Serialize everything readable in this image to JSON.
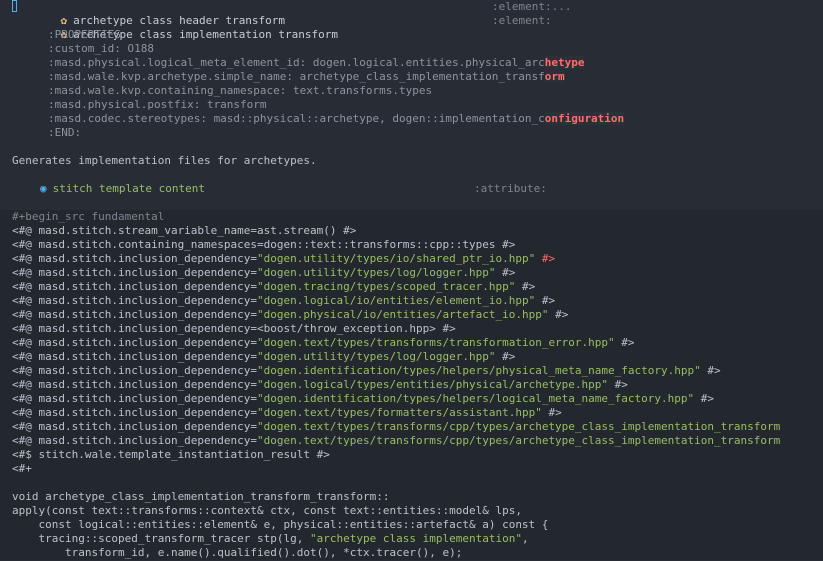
{
  "outline": {
    "header_transform": {
      "title": "archetype class header transform",
      "tag": ":element:..."
    },
    "impl_transform": {
      "title": "archetype class implementation transform",
      "tag": ":element:"
    },
    "properties": [
      ":PROPERTIES:",
      ":custom_id: O188",
      ":masd.physical.logical_meta_element_id: dogen.logical.entities.physical_arc",
      ":masd.wale.kvp.archetype.simple_name: archetype_class_implementation_transf",
      ":masd.wale.kvp.containing_namespace: text.transforms.types",
      ":masd.physical.postfix: transform",
      ":masd.codec.stereotypes: masd::physical::archetype, dogen::implementation_c",
      ":END:"
    ],
    "prop_highlights": [
      "hetype",
      "orm",
      "onfiguration"
    ],
    "description": "Generates implementation files for archetypes.",
    "subheading": {
      "title": "stitch template content",
      "tag": ":attribute:"
    }
  },
  "source": {
    "begin": "#+begin_src fundamental",
    "directives": [
      "<#@ masd.stitch.stream_variable_name=ast.stream() #>",
      "<#@ masd.stitch.containing_namespaces=dogen::text::transforms::cpp::types #>"
    ],
    "includes": [
      {
        "p": "<#@ masd.stitch.inclusion_dependency=",
        "s": "\"dogen.utility/types/io/shared_ptr_io.hpp\"",
        "e": " #>",
        "red": true
      },
      {
        "p": "<#@ masd.stitch.inclusion_dependency=",
        "s": "\"dogen.utility/types/log/logger.hpp\"",
        "e": " #>"
      },
      {
        "p": "<#@ masd.stitch.inclusion_dependency=",
        "s": "\"dogen.tracing/types/scoped_tracer.hpp\"",
        "e": " #>"
      },
      {
        "p": "<#@ masd.stitch.inclusion_dependency=",
        "s": "\"dogen.logical/io/entities/element_io.hpp\"",
        "e": " #>"
      },
      {
        "p": "<#@ masd.stitch.inclusion_dependency=",
        "s": "\"dogen.physical/io/entities/artefact_io.hpp\"",
        "e": " #>"
      },
      {
        "p": "<#@ masd.stitch.inclusion_dependency=<boost/throw_exception.hpp> #>",
        "s": "",
        "e": ""
      },
      {
        "p": "<#@ masd.stitch.inclusion_dependency=",
        "s": "\"dogen.text/types/transforms/transformation_error.hpp\"",
        "e": " #>"
      },
      {
        "p": "<#@ masd.stitch.inclusion_dependency=",
        "s": "\"dogen.utility/types/log/logger.hpp\"",
        "e": " #>"
      },
      {
        "p": "<#@ masd.stitch.inclusion_dependency=",
        "s": "\"dogen.identification/types/helpers/physical_meta_name_factory.hpp\"",
        "e": " #>"
      },
      {
        "p": "<#@ masd.stitch.inclusion_dependency=",
        "s": "\"dogen.logical/types/entities/physical/archetype.hpp\"",
        "e": " #>"
      },
      {
        "p": "<#@ masd.stitch.inclusion_dependency=",
        "s": "\"dogen.identification/types/helpers/logical_meta_name_factory.hpp\"",
        "e": " #>"
      },
      {
        "p": "<#@ masd.stitch.inclusion_dependency=",
        "s": "\"dogen.text/types/formatters/assistant.hpp\"",
        "e": " #>"
      },
      {
        "p": "<#@ masd.stitch.inclusion_dependency=",
        "s": "\"dogen.text/types/transforms/cpp/types/archetype_class_implementation_transform",
        "e": ""
      },
      {
        "p": "<#@ masd.stitch.inclusion_dependency=",
        "s": "\"dogen.text/types/transforms/cpp/types/archetype_class_implementation_transform",
        "e": ""
      }
    ],
    "tail": [
      "<#$ stitch.wale.template_instantiation_result #>",
      "<#+",
      "",
      "void archetype_class_implementation_transform_transform::",
      "apply(const text::transforms::context& ctx, const text::entities::model& lps,",
      "    const logical::entities::element& e, physical::entities::artefact& a) const {"
    ],
    "tracer_line": {
      "p": "    tracing::scoped_transform_tracer stp(lg, ",
      "s": "\"archetype class implementation\"",
      "e": ","
    },
    "last_line": "        transform_id, e.name().qualified().dot(), *ctx.tracer(), e);"
  }
}
